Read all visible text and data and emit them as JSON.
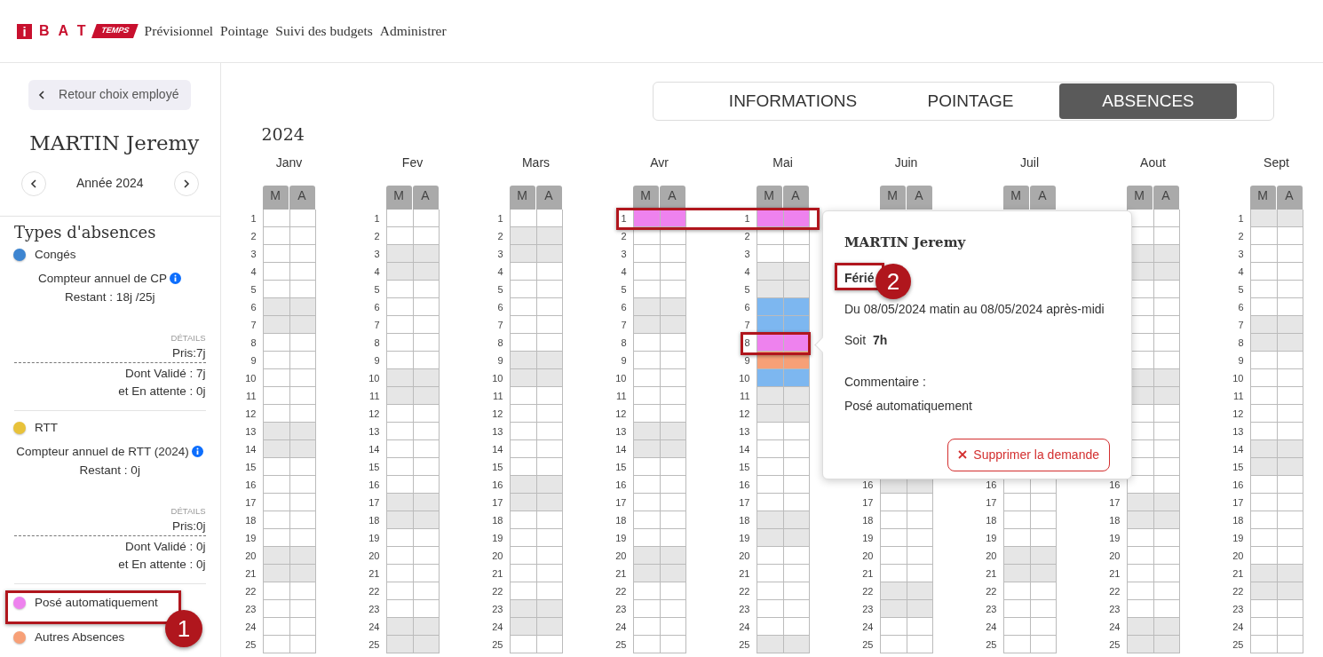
{
  "header": {
    "logo": {
      "mark": "i",
      "name": "B A T",
      "tag": "TEMPS"
    },
    "nav": [
      "Prévisionnel",
      "Pointage",
      "Suivi des budgets",
      "Administrer"
    ]
  },
  "sidebar": {
    "back_button": "Retour choix employé",
    "employee": "MARTIN Jeremy",
    "year": "Année 2024",
    "types_title": "Types d'absences",
    "absence_types": [
      {
        "kind": "counter",
        "label": "Congés",
        "color": "#3d85d1",
        "counter_title": "Compteur annuel de CP",
        "remaining": "Restant : 18j /25j",
        "details_label": "DÉTAILS",
        "taken": "Pris:7j",
        "validated": "Dont Validé : 7j",
        "pending": "et En attente : 0j"
      },
      {
        "kind": "counter",
        "label": "RTT",
        "color": "#e8c23a",
        "counter_title": "Compteur annuel de RTT (2024)",
        "remaining": "Restant : 0j",
        "details_label": "DÉTAILS",
        "taken": "Pris:0j",
        "validated": "Dont Validé : 0j",
        "pending": "et En attente : 0j"
      },
      {
        "kind": "simple",
        "label": "Posé automatiquement",
        "color": "#ee82ee"
      },
      {
        "kind": "simple",
        "label": "Autres Absences",
        "color": "#f7a077"
      }
    ]
  },
  "tabs": [
    {
      "label": "INFORMATIONS",
      "selected": false
    },
    {
      "label": "POINTAGE",
      "selected": false
    },
    {
      "label": "ABSENCES",
      "selected": true
    }
  ],
  "year": "2024",
  "months": [
    {
      "name": "Janv",
      "headers": [
        "M",
        "A"
      ],
      "days": [
        {
          "day": "1",
          "weekend": false
        },
        {
          "day": "2",
          "weekend": false
        },
        {
          "day": "3",
          "weekend": false
        },
        {
          "day": "4",
          "weekend": false
        },
        {
          "day": "5",
          "weekend": false
        },
        {
          "day": "6",
          "weekend": true
        },
        {
          "day": "7",
          "weekend": true
        },
        {
          "day": "8",
          "weekend": false
        },
        {
          "day": "9",
          "weekend": false
        },
        {
          "day": "10",
          "weekend": false
        },
        {
          "day": "11",
          "weekend": false
        },
        {
          "day": "12",
          "weekend": false
        },
        {
          "day": "13",
          "weekend": true
        },
        {
          "day": "14",
          "weekend": true
        },
        {
          "day": "15",
          "weekend": false
        },
        {
          "day": "16",
          "weekend": false
        },
        {
          "day": "17",
          "weekend": false
        },
        {
          "day": "18",
          "weekend": false
        },
        {
          "day": "19",
          "weekend": false
        },
        {
          "day": "20",
          "weekend": true
        },
        {
          "day": "21",
          "weekend": true
        },
        {
          "day": "22",
          "weekend": false
        },
        {
          "day": "23",
          "weekend": false
        },
        {
          "day": "24",
          "weekend": false
        },
        {
          "day": "25",
          "weekend": false
        }
      ]
    },
    {
      "name": "Fev",
      "headers": [
        "M",
        "A"
      ],
      "days": [
        {
          "day": "1",
          "weekend": false
        },
        {
          "day": "2",
          "weekend": false
        },
        {
          "day": "3",
          "weekend": true
        },
        {
          "day": "4",
          "weekend": true
        },
        {
          "day": "5",
          "weekend": false
        },
        {
          "day": "6",
          "weekend": false
        },
        {
          "day": "7",
          "weekend": false
        },
        {
          "day": "8",
          "weekend": false
        },
        {
          "day": "9",
          "weekend": false
        },
        {
          "day": "10",
          "weekend": true
        },
        {
          "day": "11",
          "weekend": true
        },
        {
          "day": "12",
          "weekend": false
        },
        {
          "day": "13",
          "weekend": false
        },
        {
          "day": "14",
          "weekend": false
        },
        {
          "day": "15",
          "weekend": false
        },
        {
          "day": "16",
          "weekend": false
        },
        {
          "day": "17",
          "weekend": true
        },
        {
          "day": "18",
          "weekend": true
        },
        {
          "day": "19",
          "weekend": false
        },
        {
          "day": "20",
          "weekend": false
        },
        {
          "day": "21",
          "weekend": false
        },
        {
          "day": "22",
          "weekend": false
        },
        {
          "day": "23",
          "weekend": false
        },
        {
          "day": "24",
          "weekend": true
        },
        {
          "day": "25",
          "weekend": true
        }
      ]
    },
    {
      "name": "Mars",
      "headers": [
        "M",
        "A"
      ],
      "days": [
        {
          "day": "1",
          "weekend": false
        },
        {
          "day": "2",
          "weekend": true
        },
        {
          "day": "3",
          "weekend": true
        },
        {
          "day": "4",
          "weekend": false
        },
        {
          "day": "5",
          "weekend": false
        },
        {
          "day": "6",
          "weekend": false
        },
        {
          "day": "7",
          "weekend": false
        },
        {
          "day": "8",
          "weekend": false
        },
        {
          "day": "9",
          "weekend": true
        },
        {
          "day": "10",
          "weekend": true
        },
        {
          "day": "11",
          "weekend": false
        },
        {
          "day": "12",
          "weekend": false
        },
        {
          "day": "13",
          "weekend": false
        },
        {
          "day": "14",
          "weekend": false
        },
        {
          "day": "15",
          "weekend": false
        },
        {
          "day": "16",
          "weekend": true
        },
        {
          "day": "17",
          "weekend": true
        },
        {
          "day": "18",
          "weekend": false
        },
        {
          "day": "19",
          "weekend": false
        },
        {
          "day": "20",
          "weekend": false
        },
        {
          "day": "21",
          "weekend": false
        },
        {
          "day": "22",
          "weekend": false
        },
        {
          "day": "23",
          "weekend": true
        },
        {
          "day": "24",
          "weekend": true
        },
        {
          "day": "25",
          "weekend": false
        }
      ]
    },
    {
      "name": "Avr",
      "headers": [
        "M",
        "A"
      ],
      "days": [
        {
          "day": "1",
          "color": "#ee82ee"
        },
        {
          "day": "2",
          "weekend": false
        },
        {
          "day": "3",
          "weekend": false
        },
        {
          "day": "4",
          "weekend": false
        },
        {
          "day": "5",
          "weekend": false
        },
        {
          "day": "6",
          "weekend": true
        },
        {
          "day": "7",
          "weekend": true
        },
        {
          "day": "8",
          "weekend": false
        },
        {
          "day": "9",
          "weekend": false
        },
        {
          "day": "10",
          "weekend": false
        },
        {
          "day": "11",
          "weekend": false
        },
        {
          "day": "12",
          "weekend": false
        },
        {
          "day": "13",
          "weekend": true
        },
        {
          "day": "14",
          "weekend": true
        },
        {
          "day": "15",
          "weekend": false
        },
        {
          "day": "16",
          "weekend": false
        },
        {
          "day": "17",
          "weekend": false
        },
        {
          "day": "18",
          "weekend": false
        },
        {
          "day": "19",
          "weekend": false
        },
        {
          "day": "20",
          "weekend": true
        },
        {
          "day": "21",
          "weekend": true
        },
        {
          "day": "22",
          "weekend": false
        },
        {
          "day": "23",
          "weekend": false
        },
        {
          "day": "24",
          "weekend": false
        },
        {
          "day": "25",
          "weekend": false
        }
      ]
    },
    {
      "name": "Mai",
      "headers": [
        "M",
        "A"
      ],
      "days": [
        {
          "day": "1",
          "color": "#ee82ee"
        },
        {
          "day": "2",
          "weekend": false
        },
        {
          "day": "3",
          "weekend": false
        },
        {
          "day": "4",
          "weekend": true
        },
        {
          "day": "5",
          "weekend": true
        },
        {
          "day": "6",
          "color": "#7db7f0"
        },
        {
          "day": "7",
          "color": "#7db7f0"
        },
        {
          "day": "8",
          "color": "#ee82ee"
        },
        {
          "day": "9",
          "color": "#f7a077"
        },
        {
          "day": "10",
          "color": "#7db7f0"
        },
        {
          "day": "11",
          "weekend": true
        },
        {
          "day": "12",
          "weekend": true
        },
        {
          "day": "13",
          "weekend": false
        },
        {
          "day": "14",
          "weekend": false
        },
        {
          "day": "15",
          "weekend": false
        },
        {
          "day": "16",
          "weekend": false
        },
        {
          "day": "17",
          "weekend": false
        },
        {
          "day": "18",
          "weekend": true
        },
        {
          "day": "19",
          "weekend": true
        },
        {
          "day": "20",
          "weekend": false
        },
        {
          "day": "21",
          "weekend": false
        },
        {
          "day": "22",
          "weekend": false
        },
        {
          "day": "23",
          "weekend": false
        },
        {
          "day": "24",
          "weekend": false
        },
        {
          "day": "25",
          "weekend": true
        }
      ]
    },
    {
      "name": "Juin",
      "headers": [
        "M",
        "A"
      ],
      "days": [
        {
          "day": "16",
          "weekend": true
        },
        {
          "day": "17",
          "weekend": false
        },
        {
          "day": "18",
          "weekend": false
        },
        {
          "day": "19",
          "weekend": false
        },
        {
          "day": "20",
          "weekend": false
        },
        {
          "day": "21",
          "weekend": false
        },
        {
          "day": "22",
          "weekend": true
        },
        {
          "day": "23",
          "weekend": true
        },
        {
          "day": "24",
          "weekend": false
        },
        {
          "day": "25",
          "weekend": false
        }
      ]
    },
    {
      "name": "Juil",
      "headers": [
        "M",
        "A"
      ],
      "days": [
        {
          "day": "16",
          "weekend": false
        },
        {
          "day": "17",
          "weekend": false
        },
        {
          "day": "18",
          "weekend": false
        },
        {
          "day": "19",
          "weekend": false
        },
        {
          "day": "20",
          "weekend": true
        },
        {
          "day": "21",
          "weekend": true
        },
        {
          "day": "22",
          "weekend": false
        },
        {
          "day": "23",
          "weekend": false
        },
        {
          "day": "24",
          "weekend": false
        },
        {
          "day": "25",
          "weekend": false
        }
      ]
    },
    {
      "name": "Aout",
      "headers": [
        "M",
        "A"
      ],
      "days": [
        {
          "weekend": false
        },
        {
          "weekend": false
        },
        {
          "weekend": true
        },
        {
          "weekend": true
        },
        {
          "weekend": false
        },
        {
          "weekend": false
        },
        {
          "weekend": false
        },
        {
          "weekend": false
        },
        {
          "weekend": false
        },
        {
          "weekend": true
        },
        {
          "weekend": true
        },
        {
          "weekend": false
        },
        {
          "weekend": false
        },
        {
          "weekend": false
        },
        {
          "weekend": false
        },
        {
          "day": "16",
          "weekend": false
        },
        {
          "day": "17",
          "weekend": true
        },
        {
          "day": "18",
          "weekend": true
        },
        {
          "day": "19",
          "weekend": false
        },
        {
          "day": "20",
          "weekend": false
        },
        {
          "day": "21",
          "weekend": false
        },
        {
          "day": "22",
          "weekend": false
        },
        {
          "day": "23",
          "weekend": false
        },
        {
          "day": "24",
          "weekend": true
        },
        {
          "day": "25",
          "weekend": true
        }
      ]
    },
    {
      "name": "Sept",
      "headers": [
        "M",
        "A"
      ],
      "days": [
        {
          "day": "1",
          "weekend": true
        },
        {
          "day": "2",
          "weekend": false
        },
        {
          "day": "3",
          "weekend": false
        },
        {
          "day": "4",
          "weekend": false
        },
        {
          "day": "5",
          "weekend": false
        },
        {
          "day": "6",
          "weekend": false
        },
        {
          "day": "7",
          "weekend": true
        },
        {
          "day": "8",
          "weekend": true
        },
        {
          "day": "9",
          "weekend": false
        },
        {
          "day": "10",
          "weekend": false
        },
        {
          "day": "11",
          "weekend": false
        },
        {
          "day": "12",
          "weekend": false
        },
        {
          "day": "13",
          "weekend": false
        },
        {
          "day": "14",
          "weekend": true
        },
        {
          "day": "15",
          "weekend": true
        },
        {
          "day": "16",
          "weekend": false
        },
        {
          "day": "17",
          "weekend": false
        },
        {
          "day": "18",
          "weekend": false
        },
        {
          "day": "19",
          "weekend": false
        },
        {
          "day": "20",
          "weekend": false
        },
        {
          "day": "21",
          "weekend": true
        },
        {
          "day": "22",
          "weekend": true
        },
        {
          "day": "23",
          "weekend": false
        },
        {
          "day": "24",
          "weekend": false
        },
        {
          "day": "25",
          "weekend": false
        }
      ]
    }
  ],
  "popover": {
    "employee": "MARTIN Jeremy",
    "type": "Férié",
    "period": "Du 08/05/2024 matin au 08/05/2024 après-midi",
    "total": "Soit  **7h**",
    "comment_label": "Commentaire :",
    "comment": "Posé automatiquement",
    "delete_button": "Supprimer la demande"
  },
  "annotations": [
    {
      "kind": "frame"
    },
    {
      "kind": "frame"
    },
    {
      "kind": "frame"
    },
    {
      "kind": "frame"
    },
    {
      "kind": "badge",
      "label": "1"
    },
    {
      "kind": "badge",
      "label": "2"
    }
  ]
}
